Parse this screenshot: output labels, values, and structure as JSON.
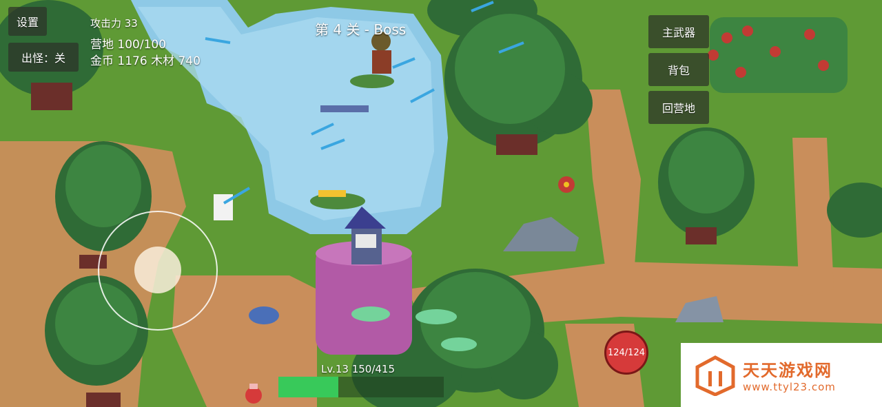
{
  "hud": {
    "settings_label": "设置",
    "spawn_toggle_label": "出怪：关",
    "attack": "攻击力 33",
    "camp": "营地 100/100",
    "resources": "金币 1176  木材 740",
    "stage_title": "第 4 关 - Boss"
  },
  "menu": {
    "main_weapon": "主武器",
    "backpack": "背包",
    "return_camp": "回营地"
  },
  "player": {
    "hp_text": "124/124",
    "level_text": "Lv.13  150/415",
    "xp_fraction": 0.361
  },
  "watermark": {
    "title": "天天游戏网",
    "url": "www.ttyl23.com",
    "color": "#e26a2c"
  },
  "icons": [
    "joystick",
    "health-orb",
    "potion-icon",
    "logo-icon"
  ]
}
